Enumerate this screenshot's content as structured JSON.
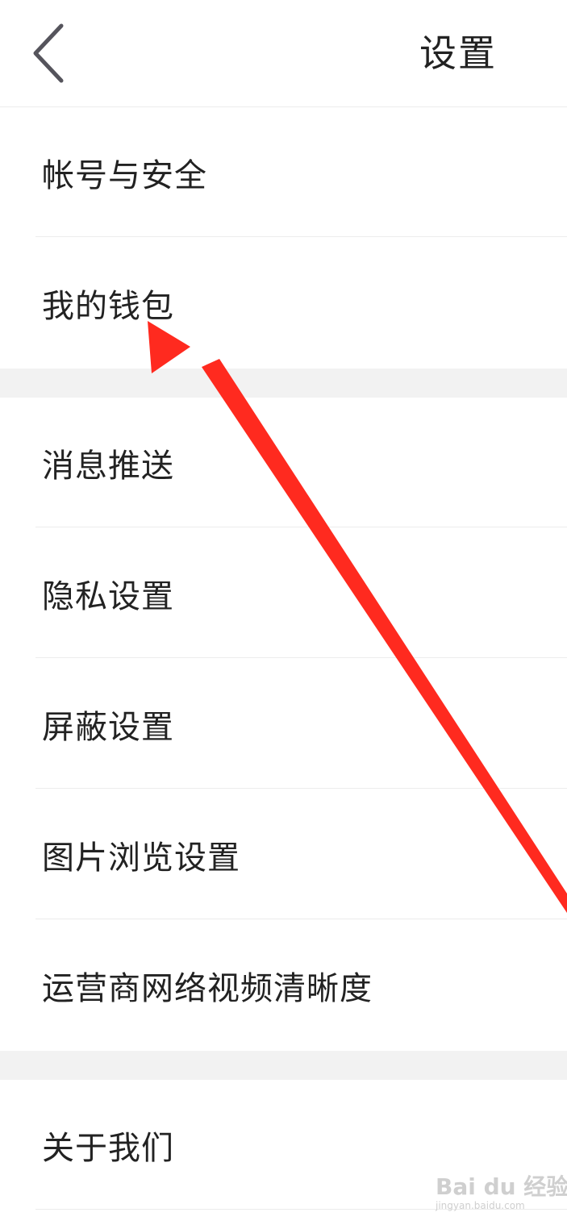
{
  "header": {
    "title": "设置"
  },
  "menu": {
    "group1": [
      "帐号与安全",
      "我的钱包"
    ],
    "group2": [
      "消息推送",
      "隐私设置",
      "屏蔽设置",
      "图片浏览设置",
      "运营商网络视频清晰度"
    ],
    "group3": [
      "关于我们"
    ]
  },
  "annotation": {
    "arrow_color": "#ff2a1f",
    "target": "我的钱包"
  },
  "watermark": {
    "logo": "Bai du 经验",
    "url": "jingyan.baidu.com"
  },
  "colors": {
    "background": "#ffffff",
    "section_gap": "#f2f2f2",
    "divider": "#ececec",
    "text": "#222222",
    "back_icon": "#55545c"
  },
  "icons": {
    "back": "chevron-left-icon"
  }
}
